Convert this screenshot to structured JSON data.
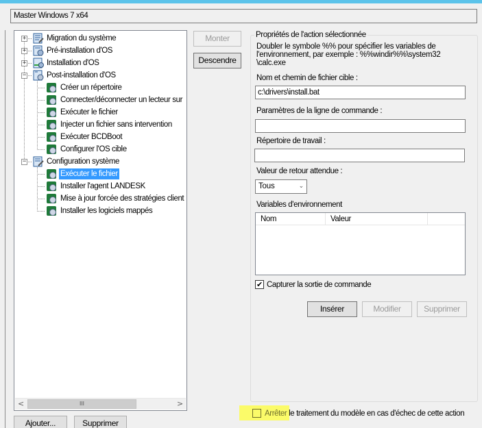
{
  "window": {
    "accent_color": "#5bc3ea",
    "template_name": "Master Windows 7 x64"
  },
  "tree": {
    "categories": [
      {
        "label": "Migration du système",
        "expanded": false,
        "icon": "migration-icon"
      },
      {
        "label": "Pré-installation d'OS",
        "expanded": false,
        "icon": "preinstall-icon"
      },
      {
        "label": "Installation d'OS",
        "expanded": false,
        "icon": "install-icon"
      },
      {
        "label": "Post-installation d'OS",
        "expanded": true,
        "icon": "postinstall-icon",
        "children": [
          "Créer un répertoire",
          "Connecter/déconnecter un lecteur sur",
          "Exécuter le fichier",
          "Injecter un fichier sans intervention",
          "Exécuter BCDBoot",
          "Configurer l'OS cible"
        ]
      },
      {
        "label": "Configuration système",
        "expanded": true,
        "icon": "sysconfig-icon",
        "children": [
          "Exécuter le fichier",
          "Installer l'agent LANDESK",
          "Mise à jour forcée des stratégies client",
          "Installer les logiciels mappés"
        ]
      }
    ],
    "selected": "Configuration système / Exécuter le fichier",
    "scroll_left_glyph": "<",
    "scroll_right_glyph": ">",
    "scroll_thumb_glyph": "III",
    "selection_color": "#3399ff"
  },
  "order_buttons": {
    "up_label": "Monter",
    "down_label": "Descendre"
  },
  "bottom_buttons": {
    "add_label": "Ajouter...",
    "delete_label": "Supprimer"
  },
  "properties": {
    "group_title": "Propriétés de l'action sélectionnée",
    "help_text_lines": [
      "Doubler le symbole %% pour spécifier les variables de",
      "l'environnement, par exemple : %%windir%%\\system32",
      "\\calc.exe"
    ],
    "target_label": "Nom et chemin de fichier cible :",
    "target_value": "c:\\drivers\\install.bat",
    "params_label": "Paramètres de la ligne de commande :",
    "params_value": "",
    "workdir_label": "Répertoire de travail :",
    "workdir_value": "",
    "return_label": "Valeur de retour attendue :",
    "return_value": "Tous",
    "env_label": "Variables d'environnement",
    "env_columns": [
      "Nom",
      "Valeur",
      ""
    ],
    "env_rows": [],
    "capture_label": "Capturer la sortie de commande",
    "capture_checked": true,
    "insert_label": "Insérer",
    "modify_label": "Modifier",
    "delete_label": "Supprimer"
  },
  "stop_on_failure": {
    "label_highlighted": "Arrêter",
    "label_rest": " le traitement du modèle en cas d'échec de cette action",
    "checked": false,
    "highlight_color": "#ffff3c"
  }
}
